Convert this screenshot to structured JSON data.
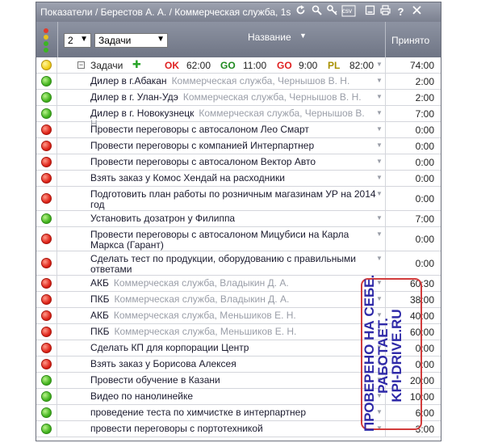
{
  "window": {
    "title": "Показатели / Берестов А. А. / Коммерческая служба, 1ѕ",
    "toolbar_icons": [
      "refresh-icon",
      "search-icon",
      "key-icon",
      "csv-export-icon",
      "minimize-icon",
      "print-icon",
      "help-icon",
      "close-icon"
    ],
    "csv_label": "csv"
  },
  "header": {
    "level_value": "2",
    "filter_value": "Задачи",
    "name_label": "Название",
    "accepted_label": "Принято"
  },
  "group": {
    "label": "Задачи",
    "ok_label": "OK",
    "ok_value": "62:00",
    "go1_label": "GO",
    "go1_value": "11:00",
    "go2_label": "GO",
    "go2_value": "9:00",
    "pl_label": "PL",
    "pl_value": "82:00",
    "accepted": "74:00",
    "status": "yellow"
  },
  "rows": [
    {
      "status": "green",
      "name": "Дилер в г.Абакан",
      "owner": "Коммерческая служба, Чернышов В. Н.",
      "accepted": "2:00",
      "lines": 1
    },
    {
      "status": "green",
      "name": "Дилер в г. Улан-Удэ",
      "owner": "Коммерческая служба, Чернышов В. Н.",
      "accepted": "2:00",
      "lines": 1
    },
    {
      "status": "green",
      "name": "Дилер в г. Новокузнецк",
      "owner": "Коммерческая служба, Чернышов В. Н.",
      "accepted": "7:00",
      "lines": 1
    },
    {
      "status": "red",
      "name": "Провести переговоры с автосалоном Лео Смарт",
      "owner": "",
      "accepted": "0:00",
      "lines": 1
    },
    {
      "status": "red",
      "name": "Провести переговоры с компанией Интерпартнер",
      "owner": "",
      "accepted": "0:00",
      "lines": 1
    },
    {
      "status": "red",
      "name": "Провести переговоры с автосалоном Вектор Авто",
      "owner": "",
      "accepted": "0:00",
      "lines": 1
    },
    {
      "status": "red",
      "name": "Взять заказ у Комос Хендай на расходники",
      "owner": "",
      "accepted": "0:00",
      "lines": 1
    },
    {
      "status": "red",
      "name": "Подготовить план работы по розничным магазинам УР на 2014 год",
      "owner": "",
      "accepted": "0:00",
      "lines": 2
    },
    {
      "status": "green",
      "name": "Установить дозатрон у Филиппа",
      "owner": "",
      "accepted": "7:00",
      "lines": 1
    },
    {
      "status": "red",
      "name": "Провести переговоры с автосалоном Мицубиси на Карла Маркса (Гарант)",
      "owner": "",
      "accepted": "0:00",
      "lines": 2
    },
    {
      "status": "red",
      "name": "Сделать тест по продукции, оборудованию с правильными ответами",
      "owner": "",
      "accepted": "0:00",
      "lines": 2
    },
    {
      "status": "red",
      "name": "АКБ",
      "owner": "Коммерческая служба, Владыкин Д. А.",
      "accepted": "60:30",
      "lines": 1
    },
    {
      "status": "red",
      "name": "ПКБ",
      "owner": "Коммерческая служба, Владыкин Д. А.",
      "accepted": "38:00",
      "lines": 1
    },
    {
      "status": "red",
      "name": "АКБ",
      "owner": "Коммерческая служба, Меньшиков Е. Н.",
      "accepted": "40:00",
      "lines": 1
    },
    {
      "status": "red",
      "name": "ПКБ",
      "owner": "Коммерческая служба, Меньшиков Е. Н.",
      "accepted": "60:00",
      "lines": 1
    },
    {
      "status": "red",
      "name": "Сделать КП для корпорации Центр",
      "owner": "",
      "accepted": "0:00",
      "lines": 1
    },
    {
      "status": "red",
      "name": "Взять заказ у Борисова Алексея",
      "owner": "",
      "accepted": "0:00",
      "lines": 1
    },
    {
      "status": "green",
      "name": "Провести обучение в Казани",
      "owner": "",
      "accepted": "20:00",
      "lines": 1
    },
    {
      "status": "green",
      "name": "Видео по нанолинейке",
      "owner": "",
      "accepted": "10:00",
      "lines": 1
    },
    {
      "status": "green",
      "name": "проведение теста по химчистке в интерпартнер",
      "owner": "",
      "accepted": "6:00",
      "lines": 1
    },
    {
      "status": "green",
      "name": "провести переговоры с портотехникой",
      "owner": "",
      "accepted": "3:00",
      "lines": 1
    }
  ],
  "stamp": {
    "line1": "ПРОВЕРЕНО НА СЕБЕ.",
    "line2": "РАБОТАЕТ.",
    "line3": "KPI-DRIVE.RU"
  }
}
